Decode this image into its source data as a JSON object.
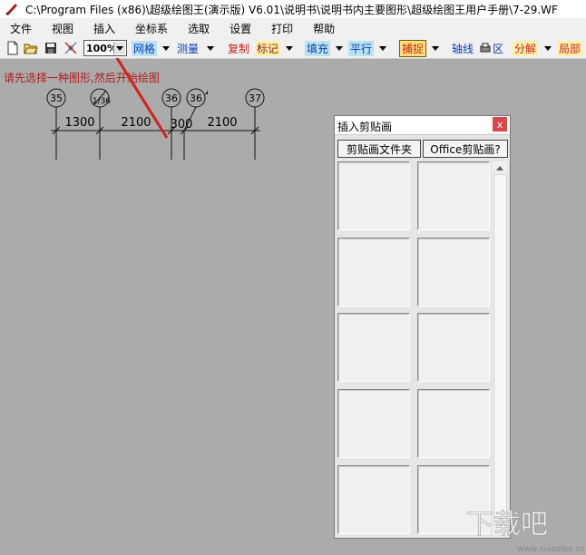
{
  "window": {
    "title": "C:\\Program Files (x86)\\超级绘图王(演示版) V6.01\\说明书\\说明书内主要图形\\超级绘图王用户手册\\7-29.WF"
  },
  "menu": [
    "文件",
    "视图",
    "插入",
    "坐标系",
    "选取",
    "设置",
    "打印",
    "帮助"
  ],
  "toolbar": {
    "zoom_value": "100%",
    "grid": "网格",
    "measure": "测量",
    "copy": "复制",
    "mark": "标记",
    "fill": "填充",
    "parallel": "平行",
    "capture": "捕捉",
    "axis": "轴线",
    "area": "区",
    "split": "分解",
    "local": "局部"
  },
  "status_message": "请先选择一种图形,然后开始绘图",
  "drawing": {
    "axis_labels": [
      "35",
      "1/36",
      "36",
      "36",
      "37"
    ],
    "dimensions": [
      "1300",
      "2100",
      "300",
      "2100"
    ]
  },
  "clipart_panel": {
    "title": "插入剪贴画",
    "close": "x",
    "folder_button": "剪贴画文件夹",
    "office_button": "Office剪贴画?"
  },
  "watermark": {
    "text": "下载吧",
    "url": "www.xiazaiba.com"
  },
  "colors": {
    "canvas": "#ababab",
    "arrow": "#d42020",
    "status_text": "#b11c1c"
  }
}
